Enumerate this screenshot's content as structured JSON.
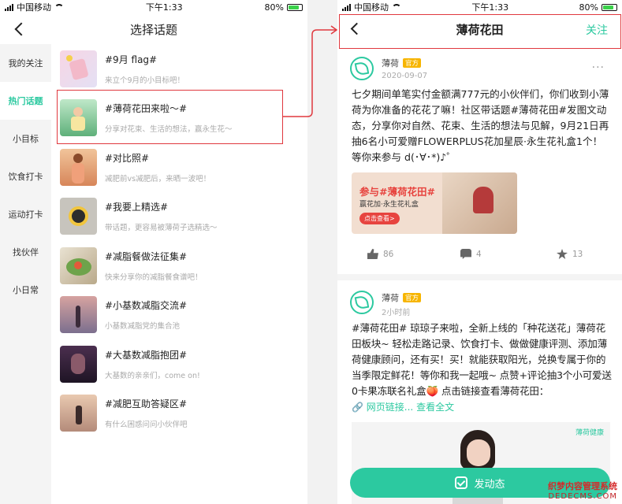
{
  "status_left": {
    "carrier": "中国移动",
    "time": "下午1:33",
    "battery": "80%"
  },
  "status_right": {
    "carrier": "中国移动",
    "time": "下午1:33",
    "battery": "80%"
  },
  "left": {
    "title": "选择话题",
    "sidebar": [
      "我的关注",
      "热门话题",
      "小目标",
      "饮食打卡",
      "运动打卡",
      "找伙伴",
      "小日常"
    ],
    "topics": [
      {
        "title": "#9月 flag#",
        "sub": "来立个9月的小目标吧！"
      },
      {
        "title": "#薄荷花田来啦～#",
        "sub": "分享对花束、生活的想法，赢永生花～"
      },
      {
        "title": "#对比照#",
        "sub": "减肥前vs减肥后，来晒一波吧！"
      },
      {
        "title": "#我要上精选#",
        "sub": "带话题，更容易被薄荷子选精选～"
      },
      {
        "title": "#减脂餐做法征集#",
        "sub": "快来分享你的减脂餐食谱吧！"
      },
      {
        "title": "#小基数减脂交流#",
        "sub": "小基数减脂党的集合池"
      },
      {
        "title": "#大基数减脂抱团#",
        "sub": "大基数的亲亲们，come on!"
      },
      {
        "title": "#减肥互助答疑区#",
        "sub": "有什么困惑问问小伙伴吧"
      }
    ]
  },
  "right": {
    "title": "薄荷花田",
    "follow": "关注",
    "post1": {
      "author": "薄荷",
      "badge": "官方",
      "date": "2020-09-07",
      "body": "七夕期间单笔实付金额满777元的小伙伴们，你们收到小薄荷为你准备的花花了嘛！社区带话题#薄荷花田#发图文动态，分享你对自然、花束、生活的想法与见解，9月21日再抽6名小可爱赠FLOWERPLUS花加星辰·永生花礼盒1个！等你来参与 d(･∀･*)♪゜",
      "banner_title": "参与#薄荷花田#",
      "banner_sub": "赢花加·永生花礼盒",
      "banner_btn": "点击查看>",
      "likes": "86",
      "comments": "4",
      "favs": "13"
    },
    "post2": {
      "author": "薄荷",
      "badge": "官方",
      "date": "2小时前",
      "body": "#薄荷花田# 琼琼子来啦，全新上线的「种花送花」薄荷花田板块~ 轻松走路记录、饮食打卡、做做健康评测、添加薄荷健康顾问，还有买！买！就能获取阳光，兑换专属于你的当季限定鲜花！等你和我一起哦~ 点赞+评论抽3个小可爱送0卡果冻联名礼盒🍑 点击链接查看薄荷花田：",
      "link": "网页链接...",
      "expand": "查看全文",
      "image_logo": "薄荷健康"
    },
    "fab": "发动态"
  },
  "watermark": {
    "line1": "织梦内容管理系统",
    "line2": "DEDECMS.COM"
  },
  "colors": {
    "accent": "#2cc9a0",
    "highlight": "#e0383e",
    "badge": "#f7b500"
  }
}
